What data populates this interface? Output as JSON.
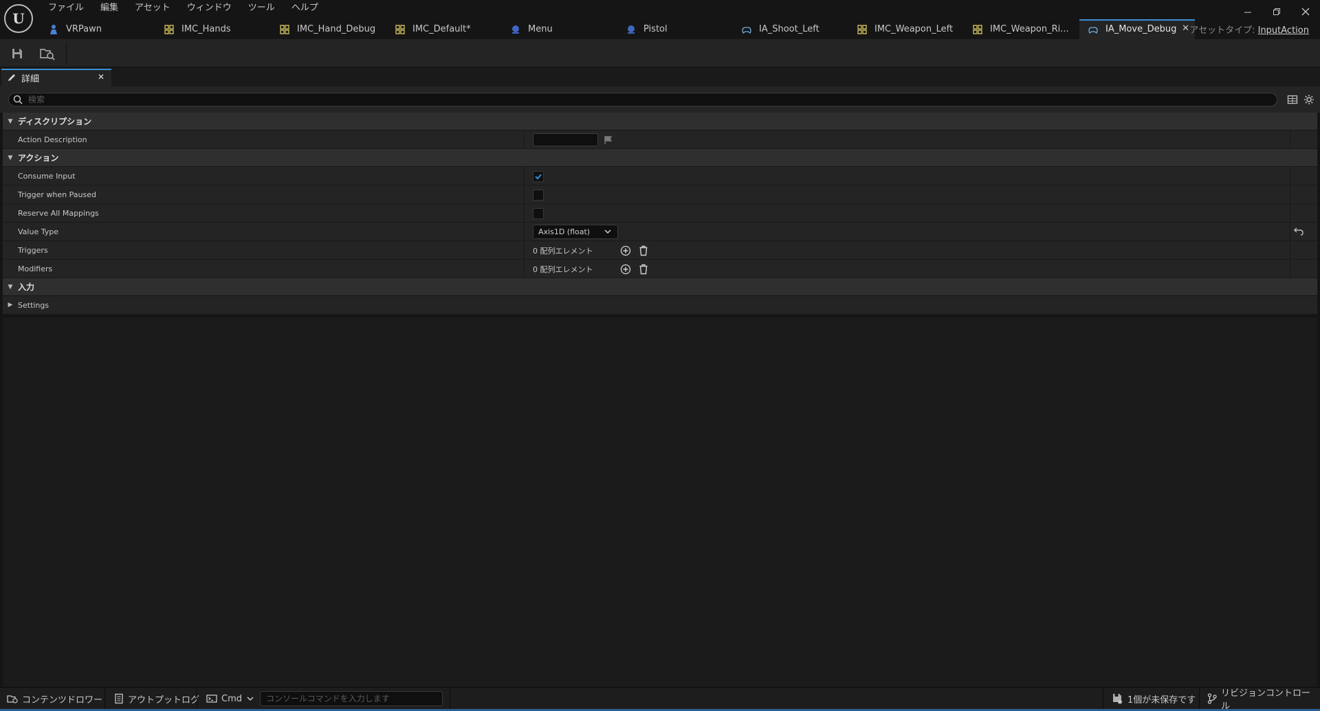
{
  "menu": [
    "ファイル",
    "編集",
    "アセット",
    "ウィンドウ",
    "ツール",
    "ヘルプ"
  ],
  "tabs": [
    {
      "label": "VRPawn",
      "icon": "pawn-icon",
      "active": false
    },
    {
      "label": "IMC_Hands",
      "icon": "mapping-context-icon",
      "active": false
    },
    {
      "label": "IMC_Hand_Debug",
      "icon": "mapping-context-icon",
      "active": false
    },
    {
      "label": "IMC_Default*",
      "icon": "mapping-context-icon",
      "active": false
    },
    {
      "label": "Menu",
      "icon": "blueprint-icon",
      "active": false
    },
    {
      "label": "Pistol",
      "icon": "blueprint-icon",
      "active": false
    },
    {
      "label": "IA_Shoot_Left",
      "icon": "input-action-icon",
      "active": false
    },
    {
      "label": "IMC_Weapon_Left",
      "icon": "mapping-context-icon",
      "active": false
    },
    {
      "label": "IMC_Weapon_Ri...",
      "icon": "mapping-context-icon",
      "active": false
    },
    {
      "label": "IA_Move_Debug",
      "icon": "input-action-icon",
      "active": true
    }
  ],
  "asset_type": {
    "label": "アセットタイプ:",
    "value": "InputAction"
  },
  "details": {
    "tab_label": "詳細",
    "search_placeholder": "検索",
    "categories": {
      "description": {
        "title": "ディスクリプション"
      },
      "action": {
        "title": "アクション"
      },
      "input": {
        "title": "入力"
      }
    },
    "props": {
      "action_description": {
        "label": "Action Description",
        "value": ""
      },
      "consume_input": {
        "label": "Consume Input",
        "checked": true
      },
      "trigger_when_paused": {
        "label": "Trigger when Paused",
        "checked": false
      },
      "reserve_all_mappings": {
        "label": "Reserve All Mappings",
        "checked": false
      },
      "value_type": {
        "label": "Value Type",
        "value": "Axis1D (float)"
      },
      "triggers": {
        "label": "Triggers",
        "count": "0 配列エレメント"
      },
      "modifiers": {
        "label": "Modifiers",
        "count": "0 配列エレメント"
      },
      "settings": {
        "label": "Settings"
      }
    }
  },
  "statusbar": {
    "content_drawer": "コンテンツドロワー",
    "output_log": "アウトプットログ",
    "cmd": "Cmd",
    "console_placeholder": "コンソールコマンドを入力します",
    "unsaved": "1個が未保存です",
    "revision_control": "リビジョンコントロール"
  },
  "colors": {
    "accent": "#3a8fd9",
    "checkbox": "#3a8fd9"
  }
}
